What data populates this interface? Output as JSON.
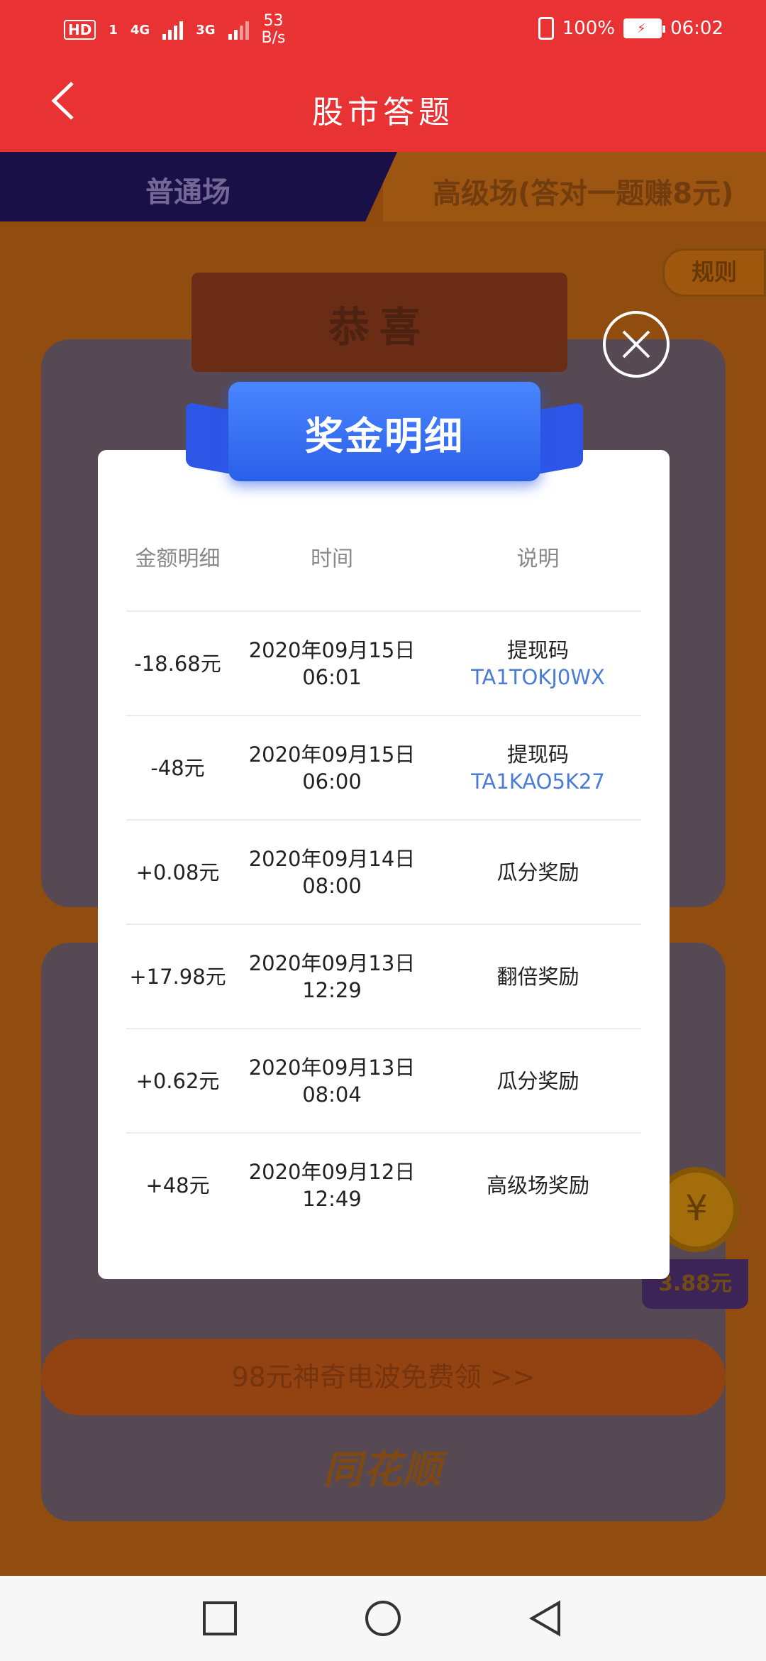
{
  "status_bar": {
    "hd": "HD",
    "sim1": "1",
    "net1": "4G",
    "net2": "3G",
    "speed_value": "53",
    "speed_unit": "B/s",
    "battery": "100%",
    "time": "06:02"
  },
  "header": {
    "title": "股市答题"
  },
  "tabs": {
    "normal": "普通场",
    "advanced": "高级场(答对一题赚8元)"
  },
  "background": {
    "rules": "规则",
    "congrats": "恭喜",
    "coin_symbol": "¥",
    "coin_amount": "3.88元",
    "promo": "98元神奇电波免费领 >>",
    "brand": "同花顺"
  },
  "modal": {
    "title": "奖金明细",
    "columns": [
      "金额明细",
      "时间",
      "说明"
    ],
    "rows": [
      {
        "amount": "-18.68元",
        "time": "2020年09月15日 06:01",
        "desc": "提现码",
        "code": "TA1TOKJ0WX"
      },
      {
        "amount": "-48元",
        "time": "2020年09月15日 06:00",
        "desc": "提现码",
        "code": "TA1KAO5K27"
      },
      {
        "amount": "+0.08元",
        "time": "2020年09月14日 08:00",
        "desc": "瓜分奖励",
        "code": ""
      },
      {
        "amount": "+17.98元",
        "time": "2020年09月13日 12:29",
        "desc": "翻倍奖励",
        "code": ""
      },
      {
        "amount": "+0.62元",
        "time": "2020年09月13日 08:04",
        "desc": "瓜分奖励",
        "code": ""
      },
      {
        "amount": "+48元",
        "time": "2020年09月12日 12:49",
        "desc": "高级场奖励",
        "code": ""
      }
    ]
  },
  "colors": {
    "header_red": "#e83234",
    "modal_blue": "#2d56e6",
    "code_blue": "#4a7bd6"
  }
}
